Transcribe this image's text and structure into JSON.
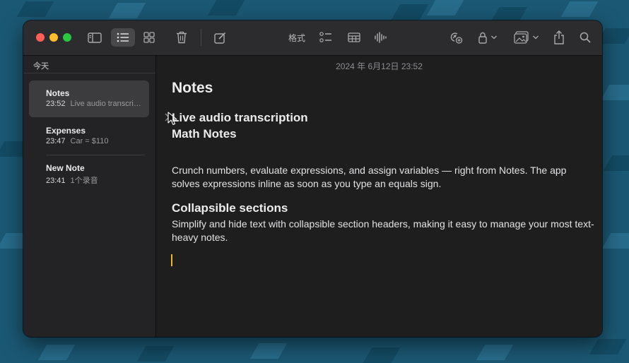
{
  "colors": {
    "accent_caret": "#f0b429",
    "traffic_close": "#ff5f57",
    "traffic_minimize": "#febc2e",
    "traffic_zoom": "#28c840"
  },
  "toolbar": {
    "format_label": "格式",
    "icons": [
      "sidebar-icon",
      "list-view-icon",
      "gallery-view-icon",
      "trash-icon",
      "compose-icon",
      "checklist-icon",
      "table-icon",
      "audio-waveform-icon",
      "collaborate-icon",
      "lock-icon",
      "media-icon",
      "share-icon",
      "search-icon"
    ]
  },
  "sidebar": {
    "section_header": "今天",
    "notes": [
      {
        "title": "Notes",
        "time": "23:52",
        "preview": "Live audio transcription"
      },
      {
        "title": "Expenses",
        "time": "23:47",
        "preview": "Car = $110"
      },
      {
        "title": "New Note",
        "time": "23:41",
        "preview": "1个录音"
      }
    ]
  },
  "editor": {
    "date": "2024 年 6月12日 23:52",
    "title": "Notes",
    "section1_heading": "Live audio transcription",
    "section2_heading": "Math Notes",
    "section2_body": "Crunch numbers, evaluate expressions, and assign variables — right from Notes. The app solves expressions inline as soon as you type an equals sign.",
    "section3_heading": "Collapsible sections",
    "section3_body": "Simplify and hide text with collapsible section headers, making it easy to manage your most text-heavy notes."
  }
}
